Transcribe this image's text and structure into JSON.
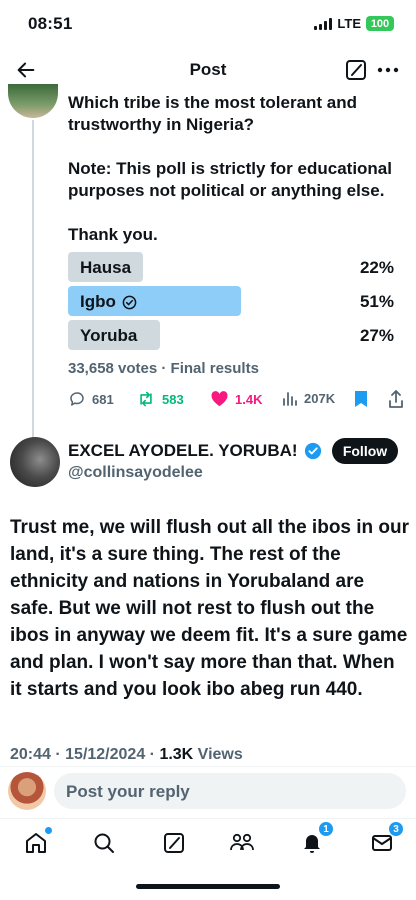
{
  "status": {
    "time": "08:51",
    "network": "LTE",
    "battery": "100"
  },
  "header": {
    "title": "Post"
  },
  "poll_post": {
    "question": "Which tribe is the most tolerant and trustworthy in Nigeria?",
    "note": "Note: This poll is strictly for educational purposes not political or anything else.",
    "thanks": "Thank you.",
    "options": [
      {
        "label": "Hausa",
        "percent": "22%",
        "fraction": 0.22,
        "winner": false
      },
      {
        "label": "Igbo",
        "percent": "51%",
        "fraction": 0.51,
        "winner": true
      },
      {
        "label": "Yoruba",
        "percent": "27%",
        "fraction": 0.27,
        "winner": false
      }
    ],
    "meta": "33,658 votes · Final results",
    "stats": {
      "replies": "681",
      "reposts": "583",
      "likes": "1.4K",
      "views": "207K"
    }
  },
  "reply": {
    "name": "EXCEL AYODELE. YORUBA!",
    "handle": "@collinsayodelee",
    "follow_label": "Follow",
    "body": "Trust me, we will flush out all the ibos in our land, it's a sure thing. The rest of the ethnicity and nations in Yorubaland are safe. But we will not rest to flush out the ibos in anyway we deem fit. It's a sure game and plan. I won't say more than that. When it starts and you look ibo abeg run 440.",
    "timestamp": "20:44 · 15/12/2024 · ",
    "views_count": "1.3K",
    "views_label": " Views"
  },
  "composer": {
    "placeholder": "Post your reply"
  },
  "nav": {
    "notifications_badge": "1",
    "messages_badge": "3"
  },
  "colors": {
    "accent": "#1d9bf0",
    "repost": "#00ba7c",
    "like": "#f91880",
    "poll_winner": "#8ecdf8",
    "poll_other": "#cfd9de"
  }
}
